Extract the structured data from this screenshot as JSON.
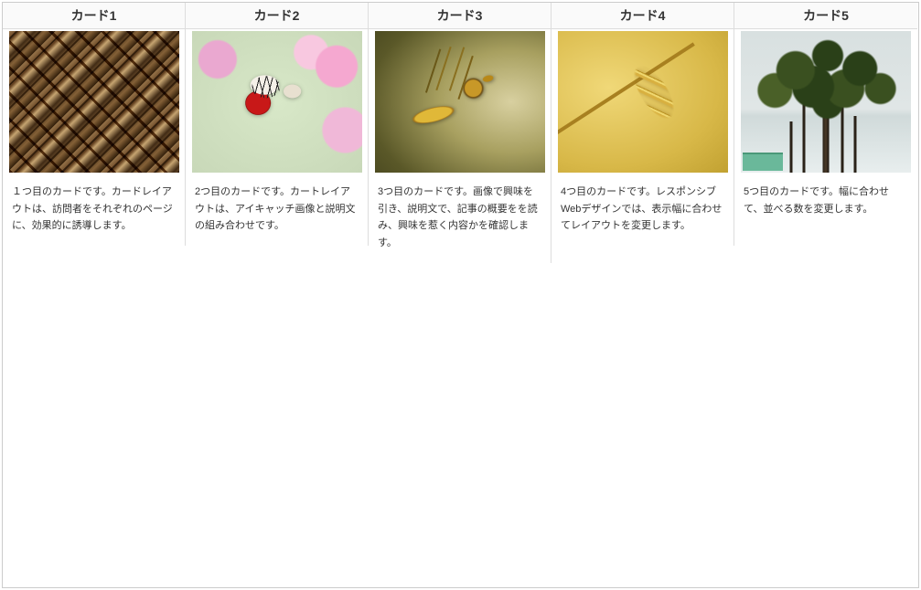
{
  "cards": [
    {
      "title": "カード1",
      "image_name": "woven-rope-texture",
      "desc": "１つ目のカードです。カードレイアウトは、訪問者をそれぞれのページに、効果的に誘導します。"
    },
    {
      "title": "カード2",
      "image_name": "butterfly-on-flowers",
      "desc": "2つ目のカードです。カートレイアウトは、アイキャッチ画像と説明文の組み合わせです。"
    },
    {
      "title": "カード3",
      "image_name": "seadragon-macro",
      "desc": "3つ目のカードです。画像で興味を引き、説明文で、記事の概要をを読み、興味を惹く内容かを確認します。"
    },
    {
      "title": "カード4",
      "image_name": "wheat-ear",
      "desc": "4つ目のカードです。レスポンシブWebデザインでは、表示幅に合わせてレイアウトを変更します。"
    },
    {
      "title": "カード5",
      "image_name": "pine-tree",
      "desc": "5つ目のカードです。幅に合わせて、並べる数を変更します。"
    }
  ]
}
